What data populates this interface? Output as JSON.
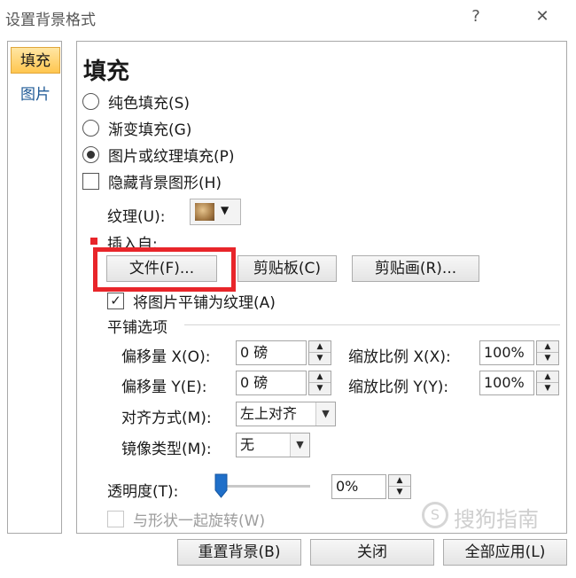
{
  "window": {
    "title": "设置背景格式",
    "help": "?",
    "close": "✕"
  },
  "nav": {
    "items": [
      {
        "label": "填充"
      },
      {
        "label": "图片"
      }
    ]
  },
  "fill": {
    "heading": "填充",
    "options": {
      "solid": "纯色填充(S)",
      "gradient": "渐变填充(G)",
      "picture": "图片或纹理填充(P)",
      "hide_bg": "隐藏背景图形(H)"
    },
    "texture_label": "纹理(U):",
    "insert_from_label": "插入自:",
    "insert_buttons": {
      "file": "文件(F)...",
      "clipboard": "剪贴板(C)",
      "clipart": "剪贴画(R)..."
    },
    "tile_checkbox": "将图片平铺为纹理(A)",
    "tile_checkbox_mark": "✓",
    "tile_options_label": "平铺选项",
    "offset_x_label": "偏移量 X(O):",
    "offset_x_value": "0 磅",
    "offset_y_label": "偏移量 Y(E):",
    "offset_y_value": "0 磅",
    "scale_x_label": "缩放比例 X(X):",
    "scale_x_value": "100%",
    "scale_y_label": "缩放比例 Y(Y):",
    "scale_y_value": "100%",
    "align_label": "对齐方式(M):",
    "align_value": "左上对齐",
    "mirror_label": "镜像类型(M):",
    "mirror_value": "无",
    "transparency_label": "透明度(T):",
    "transparency_value": "0%",
    "transparency_level": 0,
    "rotate_label": "与形状一起旋转(W)"
  },
  "footer": {
    "reset": "重置背景(B)",
    "close": "关闭",
    "apply_all": "全部应用(L)"
  },
  "watermark": "搜狗指南",
  "colors": {
    "accent_red": "#e8252a",
    "nav_active": "#ffc64f",
    "slider_thumb": "#1f6fc9"
  }
}
